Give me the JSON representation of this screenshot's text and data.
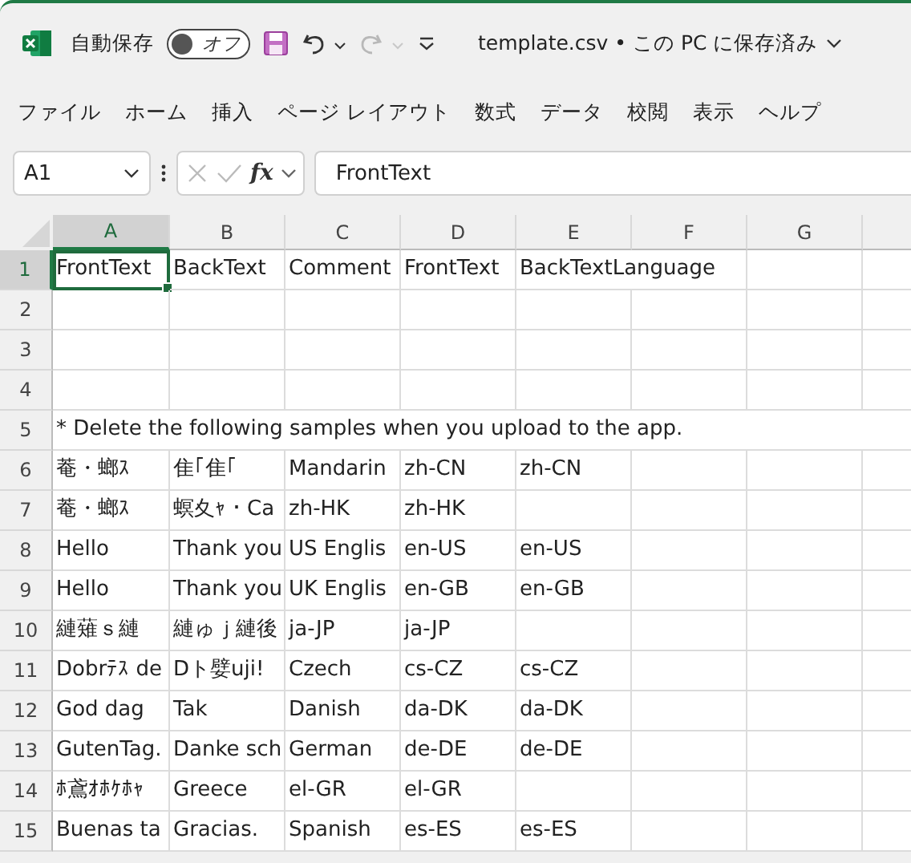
{
  "title_bar": {
    "autosave_label": "自動保存",
    "autosave_toggle": {
      "on": false,
      "label": "オフ"
    },
    "file_title": "template.csv • この PC に保存済み"
  },
  "ribbon_tabs": [
    {
      "label": "ファイル",
      "selected": false
    },
    {
      "label": "ホーム",
      "selected": false
    },
    {
      "label": "挿入",
      "selected": false
    },
    {
      "label": "ページ レイアウト",
      "selected": false
    },
    {
      "label": "数式",
      "selected": false
    },
    {
      "label": "データ",
      "selected": false
    },
    {
      "label": "校閲",
      "selected": false
    },
    {
      "label": "表示",
      "selected": false
    },
    {
      "label": "ヘルプ",
      "selected": false
    }
  ],
  "formula_bar": {
    "name_box": "A1",
    "function_label": "fx",
    "value": "FrontText"
  },
  "sheet": {
    "columns": [
      {
        "label": "A",
        "selected": true
      },
      {
        "label": "B",
        "selected": false
      },
      {
        "label": "C",
        "selected": false
      },
      {
        "label": "D",
        "selected": false
      },
      {
        "label": "E",
        "selected": false
      },
      {
        "label": "F",
        "selected": false
      },
      {
        "label": "G",
        "selected": false
      }
    ],
    "rows": [
      {
        "number": "1",
        "selected": true,
        "cells": [
          "FrontText",
          "BackText",
          "Comment",
          "FrontText",
          "BackTextLanguage"
        ]
      },
      {
        "number": "2",
        "selected": false,
        "cells": []
      },
      {
        "number": "3",
        "selected": false,
        "cells": []
      },
      {
        "number": "4",
        "selected": false,
        "cells": []
      },
      {
        "number": "5",
        "selected": false,
        "note": "* Delete the following samples when you upload to the app."
      },
      {
        "number": "6",
        "selected": false,
        "cells": [
          "菴・螂ｽ",
          "隹｢隹｢",
          "Mandarin",
          "zh-CN",
          "zh-CN"
        ]
      },
      {
        "number": "7",
        "selected": false,
        "cells": [
          "菴・螂ｽ",
          "螟夊ｬ・Ca",
          "zh-HK",
          "zh-HK"
        ]
      },
      {
        "number": "8",
        "selected": false,
        "cells": [
          "Hello",
          "Thank you",
          "US Englis",
          "en-US",
          "en-US"
        ]
      },
      {
        "number": "9",
        "selected": false,
        "cells": [
          "Hello",
          "Thank you",
          "UK Englis",
          "en-GB",
          "en-GB"
        ]
      },
      {
        "number": "10",
        "selected": false,
        "cells": [
          "縺薙ｓ縺",
          "縺ゅｊ縺後",
          "ja-JP",
          "ja-JP"
        ]
      },
      {
        "number": "11",
        "selected": false,
        "cells": [
          "Dobrﾃｽ de",
          "Dト嬖uji!",
          "Czech",
          "cs-CZ",
          "cs-CZ"
        ]
      },
      {
        "number": "12",
        "selected": false,
        "cells": [
          "God dag",
          "Tak",
          "Danish",
          "da-DK",
          "da-DK"
        ]
      },
      {
        "number": "13",
        "selected": false,
        "cells": [
          "GutenTag.",
          "Danke sch",
          "German",
          "de-DE",
          "de-DE"
        ]
      },
      {
        "number": "14",
        "selected": false,
        "cells": [
          "ﾎ鳶ｵﾎｹﾎｬ",
          "Greece",
          "el-GR",
          "el-GR"
        ]
      },
      {
        "number": "15",
        "selected": false,
        "cells": [
          "Buenas ta",
          "Gracias.",
          "Spanish",
          "es-ES",
          "es-ES"
        ]
      }
    ]
  }
}
